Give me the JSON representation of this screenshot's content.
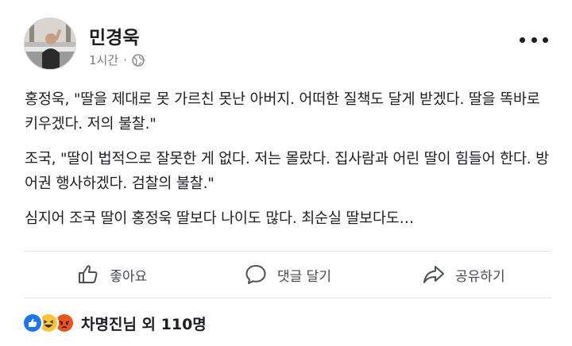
{
  "post": {
    "author": "민경욱",
    "time": "1시간",
    "separator": "·",
    "paragraphs": [
      "홍정욱, \"딸을 제대로 못 가르친 못난 아버지. 어떠한 질책도 달게 받겠다. 딸을 똑바로 키우겠다. 저의 불찰.\"",
      "조국, \"딸이 법적으로 잘못한 게 없다. 저는 몰랐다. 집사람과 어린 딸이 힘들어 한다. 방어권 행사하겠다. 검찰의 불찰.\"",
      "심지어 조국 딸이 홍정욱 딸보다 나이도 많다. 최순실 딸보다도…"
    ]
  },
  "actions": {
    "like_label": "좋아요",
    "comment_label": "댓글 달기",
    "share_label": "공유하기"
  },
  "reactions": {
    "icons": [
      "like-icon",
      "haha-icon",
      "angry-icon"
    ],
    "summary": "차명진님 외 110명"
  },
  "colors": {
    "like_blue": "#1877f2",
    "haha_yellow": "#f7c638",
    "angry_orange": "#e9541c",
    "secondary_text": "#777a80"
  }
}
